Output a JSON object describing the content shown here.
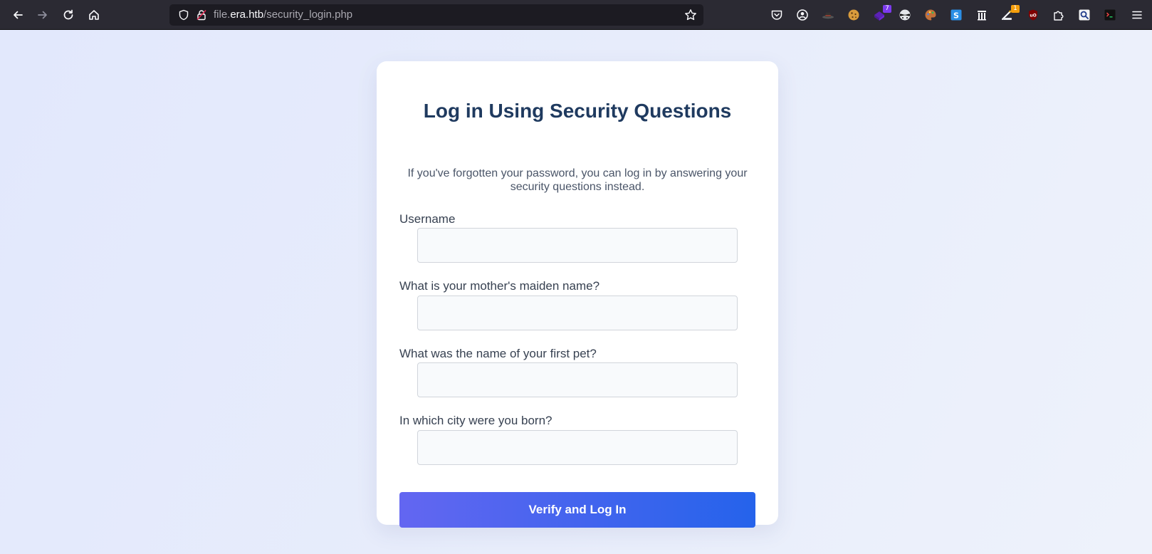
{
  "browser": {
    "url_prefix": "file.",
    "url_host": "era.htb",
    "url_path": "/security_login.php",
    "extensions": [
      {
        "name": "pocket-icon"
      },
      {
        "name": "account-icon"
      },
      {
        "name": "hat-extension-icon"
      },
      {
        "name": "cookie-extension-icon"
      },
      {
        "name": "purple-extension-icon",
        "badge": "7"
      },
      {
        "name": "mask-extension-icon"
      },
      {
        "name": "palette-extension-icon"
      },
      {
        "name": "s-extension-icon"
      },
      {
        "name": "columns-extension-icon"
      },
      {
        "name": "wand-extension-icon",
        "badge": "1"
      },
      {
        "name": "ublock-icon"
      },
      {
        "name": "puzzle-extensions-icon"
      },
      {
        "name": "search-extension-icon"
      },
      {
        "name": "terminal-extension-icon"
      },
      {
        "name": "hamburger-menu-icon"
      }
    ],
    "colors": {
      "toolbar": "#2b2a33",
      "urlbar": "#1c1b22",
      "badge_purple": "#7c3aed",
      "badge_orange": "#f59e0b"
    }
  },
  "form": {
    "title": "Log in Using Security Questions",
    "subtitle": "If you've forgotten your password, you can log in by answering your security questions instead.",
    "fields": [
      {
        "label": "Username",
        "value": "",
        "placeholder": ""
      },
      {
        "label": "What is your mother's maiden name?",
        "value": "",
        "placeholder": ""
      },
      {
        "label": "What was the name of your first pet?",
        "value": "",
        "placeholder": ""
      },
      {
        "label": "In which city were you born?",
        "value": "",
        "placeholder": ""
      }
    ],
    "submit_label": "Verify and Log In",
    "colors": {
      "title": "#1f3a5f",
      "button_start": "#6366f1",
      "button_end": "#2563eb"
    }
  }
}
